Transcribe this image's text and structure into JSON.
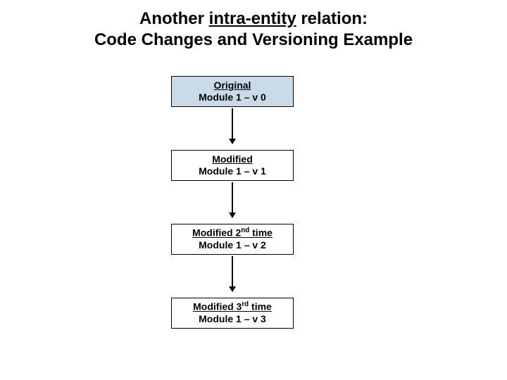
{
  "title": {
    "pre": "Another ",
    "underlined": "intra-entity",
    "post": " relation:",
    "line2": "Code Changes and Versioning Example"
  },
  "boxes": [
    {
      "line1": "Original",
      "line2": "Module 1 – v 0"
    },
    {
      "line1": "Modified",
      "line2": "Module 1 –  v 1"
    },
    {
      "line1_pre": "Modified 2",
      "line1_sup": "nd",
      "line1_post": " time",
      "line2": "Module 1 –  v 2"
    },
    {
      "line1_pre": "Modified 3",
      "line1_sup": "rd",
      "line1_post": " time",
      "line2": "Module 1 –  v 3"
    }
  ]
}
